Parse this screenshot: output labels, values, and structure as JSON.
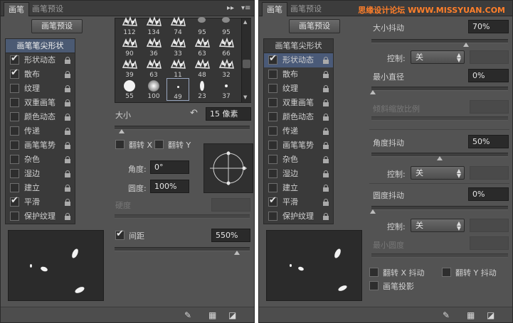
{
  "left": {
    "tabs": [
      "画笔",
      "画笔预设"
    ],
    "presets_button": "画笔预设",
    "list_header": "画笔笔尖形状",
    "list_items": [
      {
        "label": "形状动态",
        "checked": true
      },
      {
        "label": "散布",
        "checked": true
      },
      {
        "label": "纹理",
        "checked": false
      },
      {
        "label": "双重画笔",
        "checked": false
      },
      {
        "label": "颜色动态",
        "checked": false
      },
      {
        "label": "传递",
        "checked": false
      },
      {
        "label": "画笔笔势",
        "checked": false
      },
      {
        "label": "杂色",
        "checked": false
      },
      {
        "label": "湿边",
        "checked": false
      },
      {
        "label": "建立",
        "checked": false
      },
      {
        "label": "平滑",
        "checked": true
      },
      {
        "label": "保护纹理",
        "checked": false
      }
    ],
    "tip_sizes": [
      "112",
      "134",
      "74",
      "95",
      "95",
      "90",
      "36",
      "33",
      "63",
      "66",
      "39",
      "63",
      "11",
      "48",
      "32",
      "55",
      "100",
      "49",
      "23",
      "37"
    ],
    "size": {
      "label": "大小",
      "value": "15 像素",
      "reset_icon": "↶",
      "slider_fraction": 0.05
    },
    "flip_x": "翻转 X",
    "flip_y": "翻转 Y",
    "angle": {
      "label": "角度:",
      "value": "0°"
    },
    "roundness": {
      "label": "圆度:",
      "value": "100%"
    },
    "hardness": {
      "label": "硬度"
    },
    "spacing": {
      "label": "间距",
      "value": "550%",
      "checked": true,
      "slider_fraction": 0.9
    }
  },
  "right": {
    "tabs": [
      "画笔",
      "画笔预设"
    ],
    "watermark": "思缘设计论坛 WWW.MISSYUAN.COM",
    "presets_button": "画笔预设",
    "list_header": "画笔笔尖形状",
    "list_items": [
      {
        "label": "形状动态",
        "checked": true
      },
      {
        "label": "散布",
        "checked": false
      },
      {
        "label": "纹理",
        "checked": false
      },
      {
        "label": "双重画笔",
        "checked": false
      },
      {
        "label": "颜色动态",
        "checked": false
      },
      {
        "label": "传递",
        "checked": false
      },
      {
        "label": "画笔笔势",
        "checked": false
      },
      {
        "label": "杂色",
        "checked": false
      },
      {
        "label": "湿边",
        "checked": false
      },
      {
        "label": "建立",
        "checked": false
      },
      {
        "label": "平滑",
        "checked": true
      },
      {
        "label": "保护纹理",
        "checked": false
      }
    ],
    "size_jitter": {
      "label": "大小抖动",
      "value": "70%",
      "slider_fraction": 0.7
    },
    "control_label": "控制:",
    "control_value": "关",
    "min_diameter": {
      "label": "最小直径",
      "value": "0%",
      "slider_fraction": 0.0
    },
    "tilt_scale": {
      "label": "倾斜缩放比例"
    },
    "angle_jitter": {
      "label": "角度抖动",
      "value": "50%",
      "slider_fraction": 0.5
    },
    "roundness_jitter": {
      "label": "圆度抖动",
      "value": "0%",
      "slider_fraction": 0.0
    },
    "min_roundness": {
      "label": "最小圆度"
    },
    "flip_x_jitter": "翻转 X 抖动",
    "flip_y_jitter": "翻转 Y 抖动",
    "brush_projection": "画笔投影"
  },
  "colors": {
    "panel": "#535353",
    "selection": "#4a5a78",
    "field": "#2a2a2a"
  }
}
